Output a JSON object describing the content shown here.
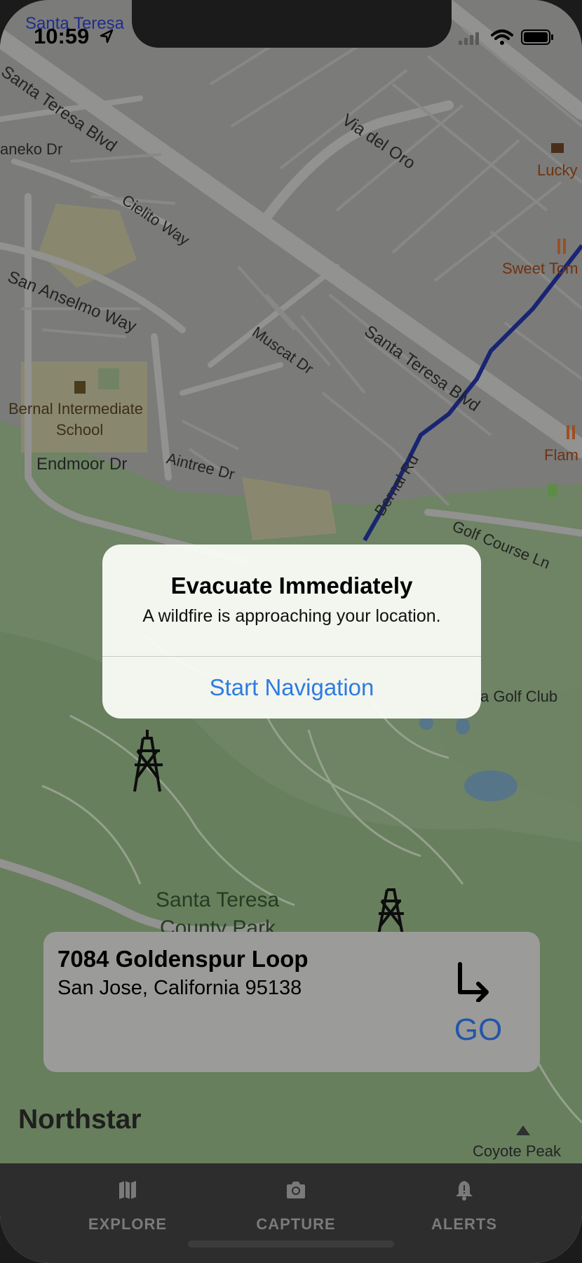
{
  "status_bar": {
    "time": "10:59",
    "top_label": "Santa Teresa"
  },
  "map": {
    "streets": [
      "Santa Teresa Blvd",
      "Via del Oro",
      "aneko Dr",
      "Cielito Way",
      "San Anselmo Way",
      "Muscat Dr",
      "Santa Teresa Blvd",
      "Bernal Rd",
      "Golf Course Ln",
      "Aintree Dr",
      "Endmoor Dr"
    ],
    "pois": [
      "Lucky",
      "Sweet Tom",
      "Flam",
      "sa Golf Club"
    ],
    "school": [
      "Bernal Intermediate",
      "School"
    ],
    "park": [
      "Santa Teresa",
      "County Park"
    ],
    "peak": "Coyote Peak"
  },
  "alert": {
    "title": "Evacuate Immediately",
    "message": "A wildfire is approaching your location.",
    "action": "Start Navigation"
  },
  "destination": {
    "address_line1": "7084 Goldenspur Loop",
    "address_line2": "San Jose, California 95138",
    "go_label": "GO",
    "turn_icon": "turn-right-arrow-icon"
  },
  "app_name": "Northstar",
  "tabs": [
    {
      "label": "EXPLORE",
      "icon": "map-icon"
    },
    {
      "label": "CAPTURE",
      "icon": "camera-icon"
    },
    {
      "label": "ALERTS",
      "icon": "bell-icon"
    }
  ],
  "colors": {
    "alert_action": "#2f7be0",
    "go_button": "#2356a8",
    "route_line": "#1f2e8c",
    "park_green": "#7e9a70"
  }
}
